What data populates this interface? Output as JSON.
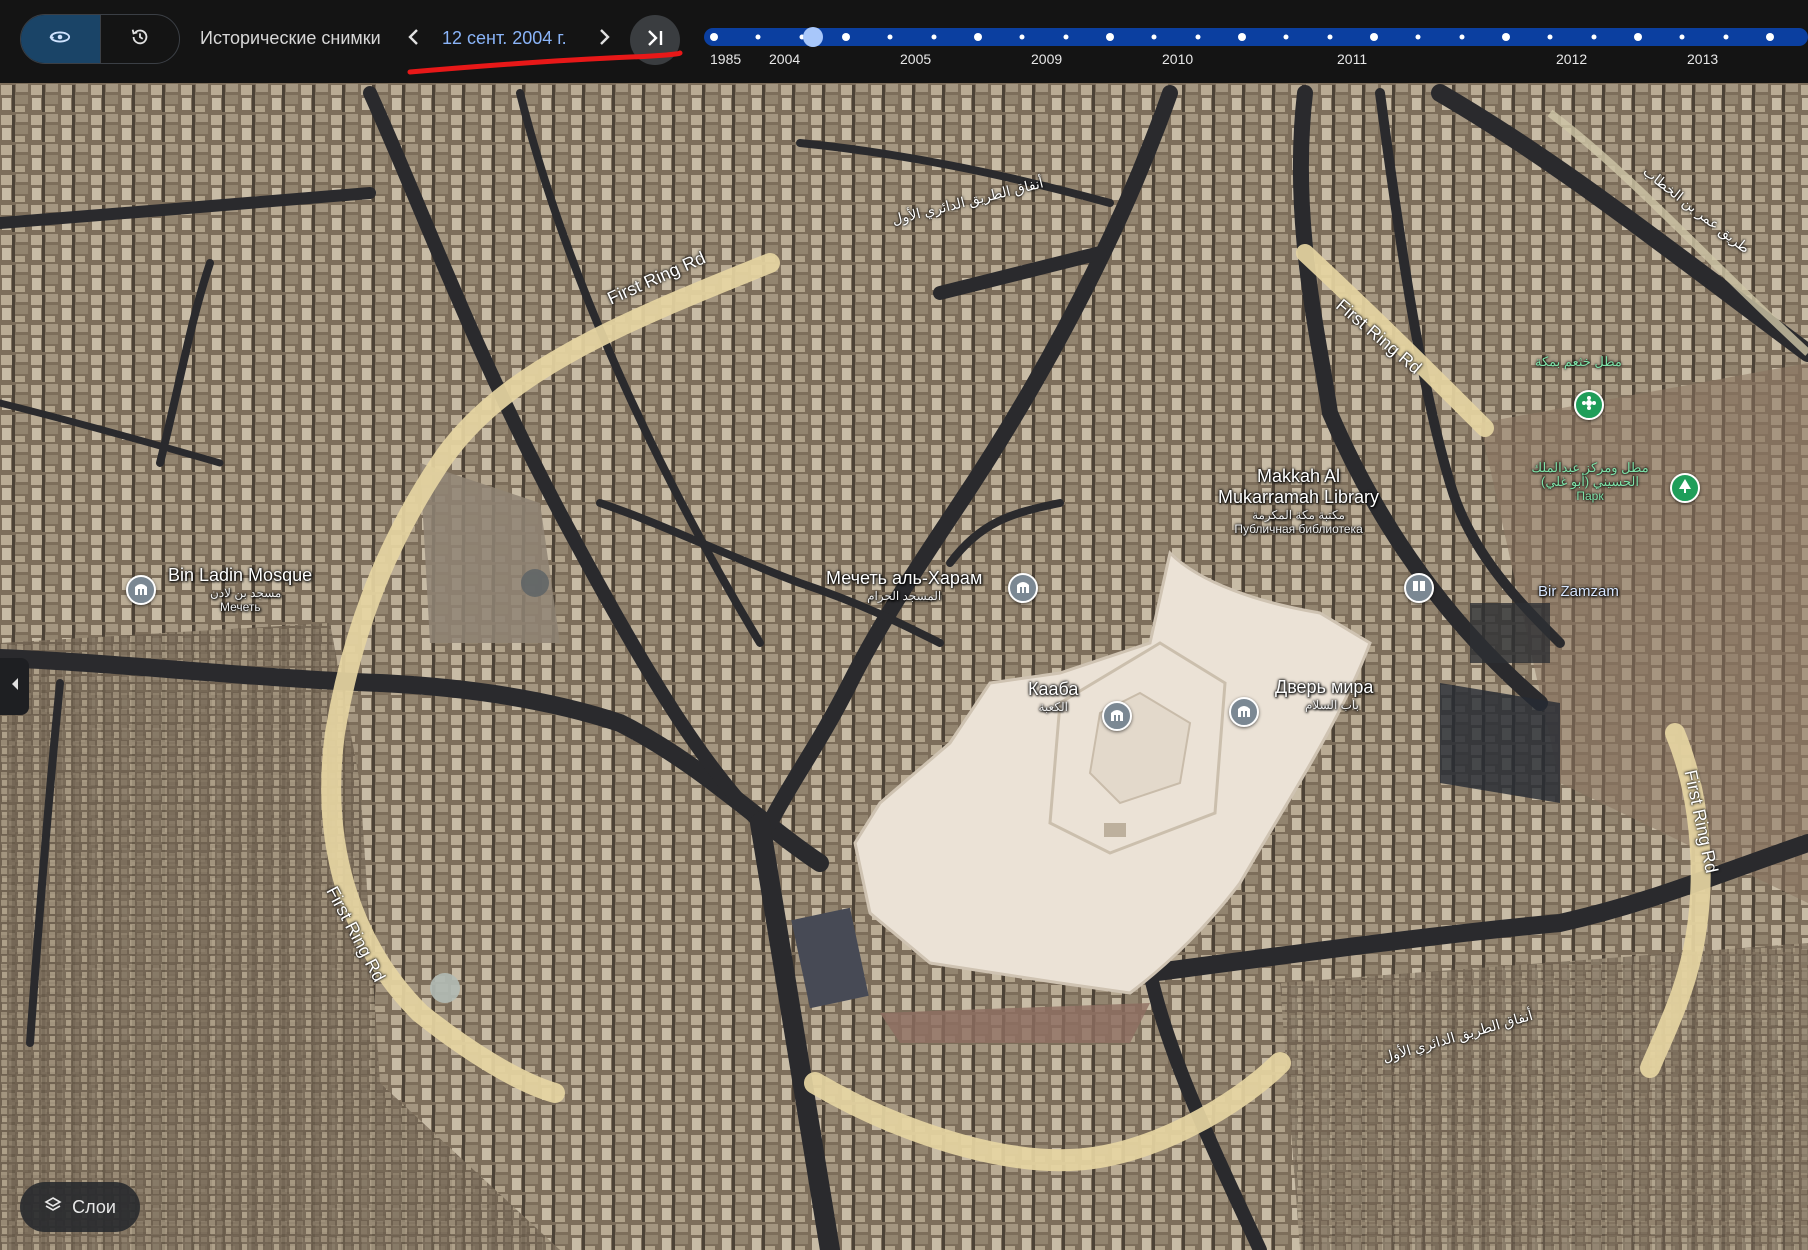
{
  "toolbar": {
    "historical_label": "Исторические снимки",
    "date_label": "12 сент. 2004 г.",
    "mode_3d_icon": "rotate-3d-icon",
    "history_icon": "history-clock-icon",
    "prev_icon": "chevron-left-icon",
    "next_icon": "chevron-right-icon",
    "latest_icon": "skip-to-latest-icon"
  },
  "timeline": {
    "years": [
      "1985",
      "2004",
      "2005",
      "2009",
      "2010",
      "2011",
      "2012",
      "2013"
    ],
    "selected": "12 сент. 2004 г.",
    "bar_color": "#0b3fa0",
    "dot_color": "#ffffff",
    "selected_color": "#a8c7fa"
  },
  "map": {
    "labels": {
      "bin_ladin_title": "Bin Ladin Mosque",
      "bin_ladin_ar": "مسجد بن لادن",
      "bin_ladin_type": "Мечеть",
      "haram_title": "Мечеть аль-Харам",
      "haram_ar": "المسجد الحرام",
      "kaaba_title": "Кааба",
      "kaaba_ar": "الكعبة",
      "peace_title": "Дверь мира",
      "peace_ar": "باب السلام",
      "library_title_1": "Makkah Al",
      "library_title_2": "Mukarramah Library",
      "library_ar": "مكتبة مكة المكرمة",
      "library_type": "Публичная библиотека",
      "zamzam_title": "Bir Zamzam",
      "park1_ar": "مطل خثعم بمكة",
      "park2_ar": "مطل ومركز عبدالملك الحسيني (أبو غلي)",
      "park2_type": "Парк"
    },
    "roads": {
      "ring_nw": "First Ring Rd",
      "ring_ne": "First Ring Rd",
      "ring_sw": "First Ring Rd",
      "ring_e": "First Ring Rd",
      "tunnel_n": "أنفاق الطريق الدائري الأول",
      "tunnel_se": "أنفاق الطريق الدائري الأول",
      "umar_road": "طريق عمر بن الخطاب"
    },
    "icons": {
      "mosque_pin": "mosque-pin-icon",
      "library_pin": "library-pin-icon",
      "park_pin": "tree-pin-icon",
      "viewpoint_pin": "viewpoint-pin-icon"
    },
    "colors": {
      "ring_road": "#e6d5a2",
      "haram_floor": "#ece3d8",
      "terrain": "#7e6f5c"
    }
  },
  "controls": {
    "layers_label": "Слои",
    "layers_icon": "layers-icon",
    "side_panel_icon": "chevron-left-icon"
  }
}
